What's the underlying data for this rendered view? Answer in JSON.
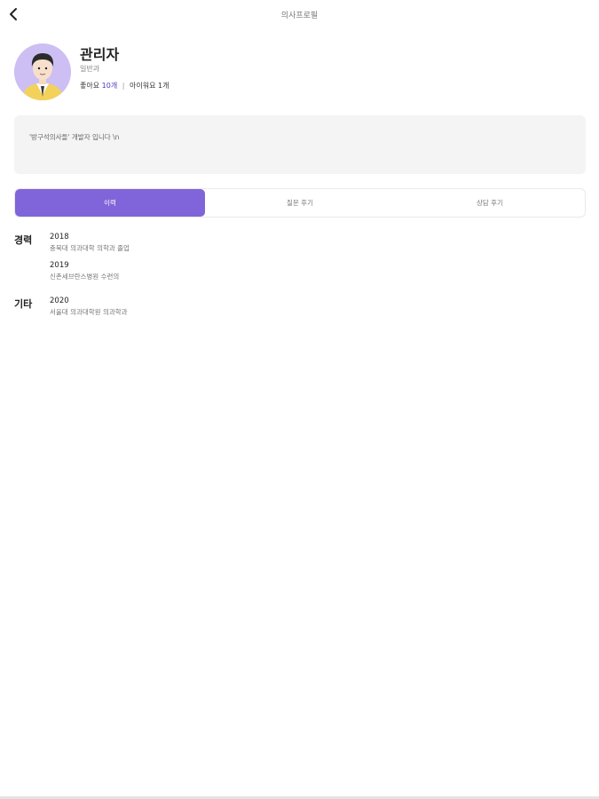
{
  "header": {
    "title": "의사프로필",
    "back_icon": "chevron-left-icon"
  },
  "profile": {
    "name": "관리자",
    "role": "일반과",
    "likes_label": "좋아요",
    "likes_count": "10개",
    "separator": "|",
    "ideas_label": "아이워요",
    "ideas_count": "1개",
    "avatar_bg": "#cdbff3"
  },
  "intro": {
    "text": "'방구석의사들' 개발자 입니다 \\n"
  },
  "tabs": [
    {
      "label": "이력",
      "active": true
    },
    {
      "label": "질문 후기",
      "active": false
    },
    {
      "label": "상담 후기",
      "active": false
    }
  ],
  "accent_color": "#8064d9",
  "sections": [
    {
      "title": "경력",
      "entries": [
        {
          "year": "2018",
          "desc": "충북대 의과대학 의학과 졸업"
        },
        {
          "year": "2019",
          "desc": "신촌세브란스병원 수련의"
        }
      ]
    },
    {
      "title": "기타",
      "entries": [
        {
          "year": "2020",
          "desc": "서울대 의과대학원 의과학과"
        }
      ]
    }
  ]
}
